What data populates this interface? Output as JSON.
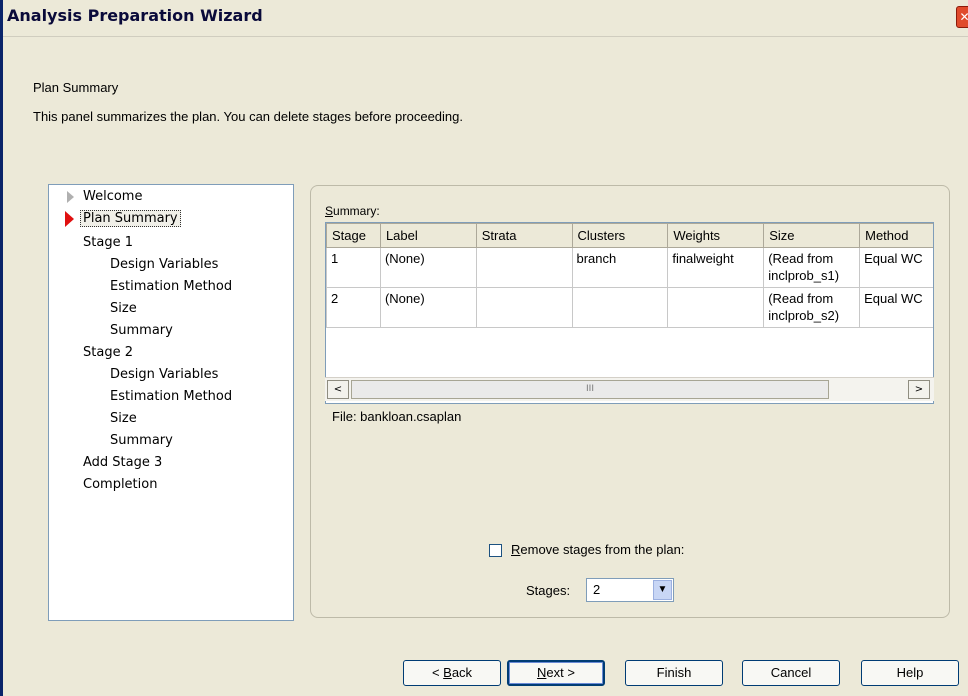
{
  "window": {
    "title": "Analysis Preparation Wizard",
    "close_glyph": "✕"
  },
  "header": {
    "title": "Plan Summary",
    "description": "This panel summarizes the plan.  You can delete stages before proceeding."
  },
  "tree": {
    "items": [
      {
        "label": "Welcome"
      },
      {
        "label": "Plan Summary"
      },
      {
        "label": "Stage 1"
      },
      {
        "label": "Design Variables"
      },
      {
        "label": "Estimation Method"
      },
      {
        "label": "Size"
      },
      {
        "label": "Summary"
      },
      {
        "label": "Stage 2"
      },
      {
        "label": "Design Variables"
      },
      {
        "label": "Estimation Method"
      },
      {
        "label": "Size"
      },
      {
        "label": "Summary"
      },
      {
        "label": "Add Stage 3"
      },
      {
        "label": "Completion"
      }
    ]
  },
  "summary": {
    "label_mnemonic": "S",
    "label_rest": "ummary:",
    "columns": [
      "Stage",
      "Label",
      "Strata",
      "Clusters",
      "Weights",
      "Size",
      "Method"
    ],
    "rows": [
      {
        "stage": "1",
        "label": "(None)",
        "strata": "",
        "clusters": "branch",
        "weights": "finalweight",
        "size_line1": "(Read from",
        "size_line2": "inclprob_s1)",
        "method": "Equal WC"
      },
      {
        "stage": "2",
        "label": "(None)",
        "strata": "",
        "clusters": "",
        "weights": "",
        "size_line1": "(Read from",
        "size_line2": "inclprob_s2)",
        "method": "Equal WC"
      }
    ],
    "scroll_left": "<",
    "scroll_right": ">",
    "scroll_grip": "III",
    "file_label": "File:  bankloan.csaplan"
  },
  "remove": {
    "label_mnemonic": "R",
    "label_rest": "emove stages from the plan:",
    "checked": false,
    "stages_pre": "Sta",
    "stages_mnemonic": "g",
    "stages_post": "es:",
    "stages_value": "2",
    "dropdown_glyph": "▼"
  },
  "buttons": {
    "back_pre": "< ",
    "back_mnemonic": "B",
    "back_rest": "ack",
    "next_mnemonic": "N",
    "next_rest": "ext >",
    "finish": "Finish",
    "cancel": "Cancel",
    "help": "Help"
  }
}
